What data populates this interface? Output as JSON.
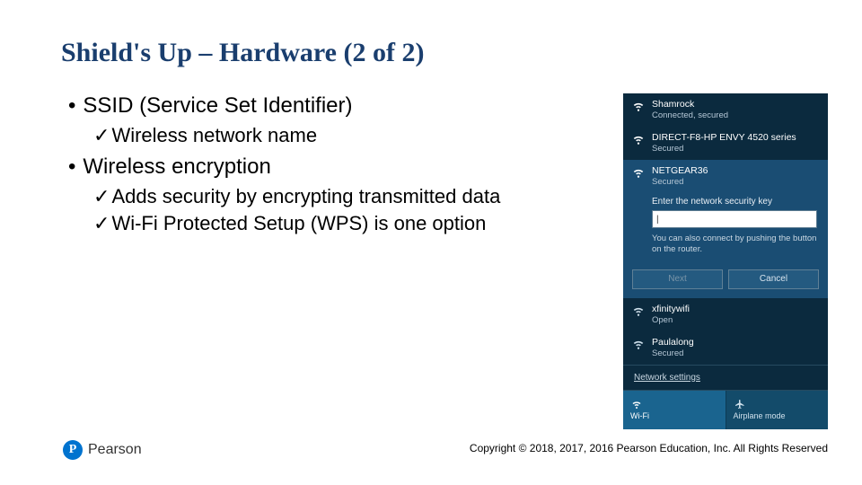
{
  "title": "Shield's Up – Hardware (2 of 2)",
  "bullets": [
    {
      "level": 1,
      "text": "SSID (Service Set Identifier)"
    },
    {
      "level": 2,
      "text": "Wireless network name"
    },
    {
      "level": 1,
      "text": "Wireless encryption"
    },
    {
      "level": 2,
      "text": "Adds security by encrypting transmitted data"
    },
    {
      "level": 2,
      "text": "Wi-Fi Protected Setup (WPS) is one option"
    }
  ],
  "flyout": {
    "networks": [
      {
        "name": "Shamrock",
        "status": "Connected, secured",
        "secured": true
      },
      {
        "name": "DIRECT-F8-HP ENVY 4520 series",
        "status": "Secured",
        "secured": true
      },
      {
        "name": "NETGEAR36",
        "status": "Secured",
        "secured": true,
        "selected": true
      },
      {
        "name": "xfinitywifi",
        "status": "Open",
        "secured": false
      },
      {
        "name": "Paulalong",
        "status": "Secured",
        "secured": true
      }
    ],
    "security_prompt": "Enter the network security key",
    "input_value": "|",
    "hint": "You can also connect by pushing the button on the router.",
    "next_label": "Next",
    "cancel_label": "Cancel",
    "settings_label": "Network settings",
    "tile_wifi": "Wi-Fi",
    "tile_airplane": "Airplane mode"
  },
  "logo": {
    "initial": "P",
    "brand": "Pearson"
  },
  "copyright": "Copyright © 2018, 2017, 2016 Pearson Education, Inc. All Rights Reserved"
}
